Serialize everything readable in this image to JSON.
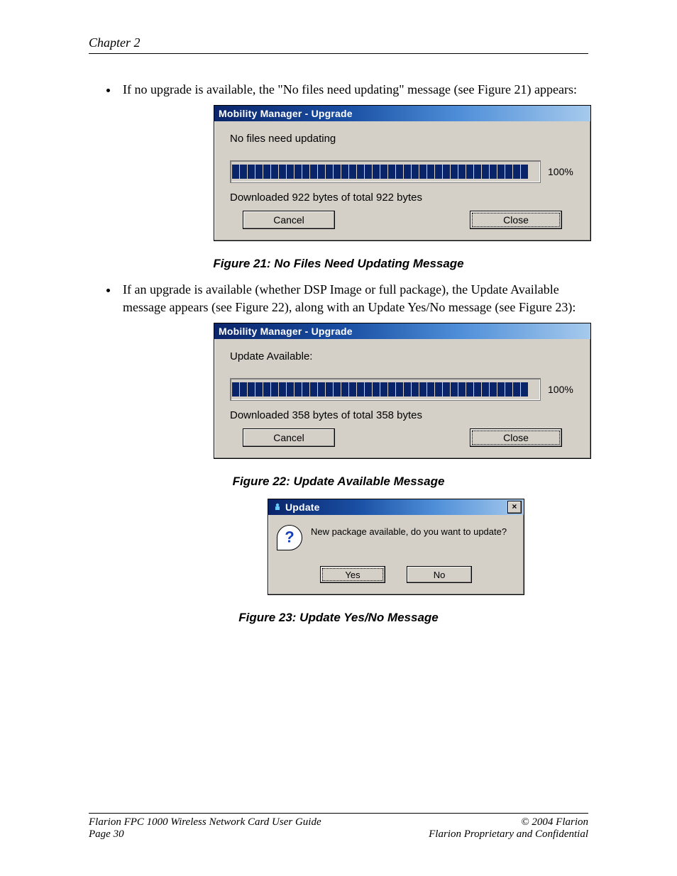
{
  "header": {
    "chapter": "Chapter 2"
  },
  "bullets": {
    "b1": "If no upgrade is available, the \"No files need updating\" message (see Figure 21) appears:",
    "b2": "If an upgrade is available (whether DSP Image or full package), the Update Available message appears (see Figure 22), along with an Update Yes/No message (see Figure 23):"
  },
  "fig21": {
    "title": "Mobility Manager - Upgrade",
    "status": "No files need updating",
    "percent": "100%",
    "download": "Downloaded 922 bytes of total 922 bytes",
    "cancel": "Cancel",
    "close": "Close",
    "caption": "Figure 21: No Files Need Updating Message"
  },
  "fig22": {
    "title": "Mobility Manager - Upgrade",
    "status": "Update Available:",
    "percent": "100%",
    "download": "Downloaded 358 bytes of total 358 bytes",
    "cancel": "Cancel",
    "close": "Close",
    "caption": "Figure 22: Update Available Message"
  },
  "fig23": {
    "title": "Update",
    "close_x": "×",
    "question": "New package available, do you want to update?",
    "yes": "Yes",
    "no": "No",
    "caption": "Figure 23: Update Yes/No Message"
  },
  "footer": {
    "guide": "Flarion FPC 1000 Wireless Network Card User Guide",
    "page": "Page 30",
    "copyright": "© 2004 Flarion",
    "confidential": "Flarion Proprietary and Confidential"
  }
}
